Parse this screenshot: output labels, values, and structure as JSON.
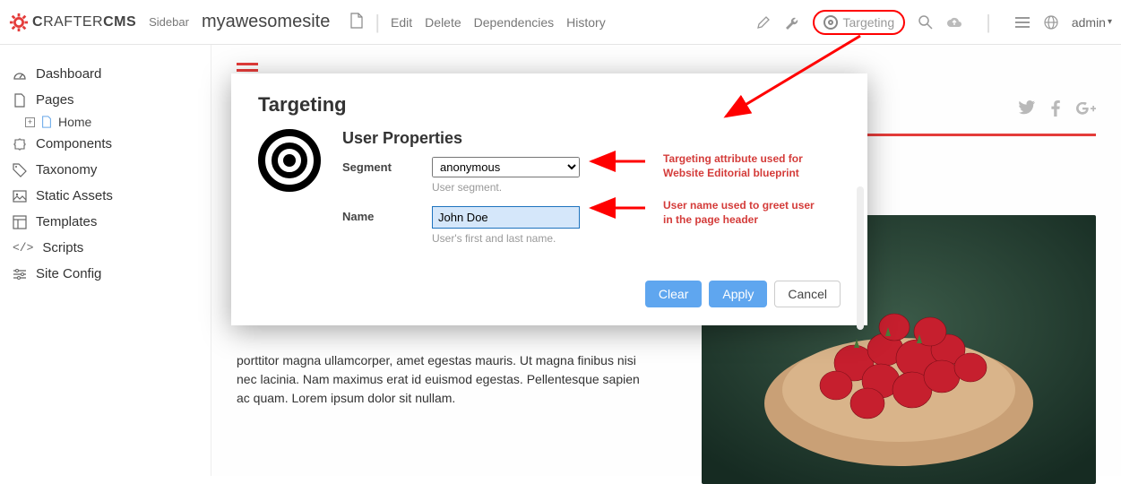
{
  "header": {
    "logo_text": "CRAFTERCMS",
    "sidebar_toggle": "Sidebar",
    "site_name": "myawesomesite",
    "actions": [
      "Edit",
      "Delete",
      "Dependencies",
      "History"
    ],
    "targeting_label": "Targeting",
    "admin_label": "admin"
  },
  "sidebar": {
    "items": [
      {
        "icon": "dashboard",
        "label": "Dashboard"
      },
      {
        "icon": "page",
        "label": "Pages"
      },
      {
        "icon": "components",
        "label": "Components"
      },
      {
        "icon": "tag",
        "label": "Taxonomy"
      },
      {
        "icon": "image",
        "label": "Static Assets"
      },
      {
        "icon": "template",
        "label": "Templates"
      },
      {
        "icon": "code",
        "label": "Scripts"
      },
      {
        "icon": "sliders",
        "label": "Site Config"
      }
    ],
    "sub_home": "Home"
  },
  "page": {
    "body_text": "porttitor magna ullamcorper, amet egestas mauris. Ut magna finibus nisi nec lacinia. Nam maximus erat id euismod egestas. Pellentesque sapien ac quam. Lorem ipsum dolor sit nullam."
  },
  "modal": {
    "title": "Targeting",
    "section_title": "User Properties",
    "fields": {
      "segment": {
        "label": "Segment",
        "value": "anonymous",
        "hint": "User segment."
      },
      "name": {
        "label": "Name",
        "value": "John Doe",
        "hint": "User's first and last name."
      }
    },
    "buttons": {
      "clear": "Clear",
      "apply": "Apply",
      "cancel": "Cancel"
    }
  },
  "annotations": {
    "segment": "Targeting attribute used for Website Editorial blueprint",
    "name": "User name used to greet user in the page header"
  }
}
